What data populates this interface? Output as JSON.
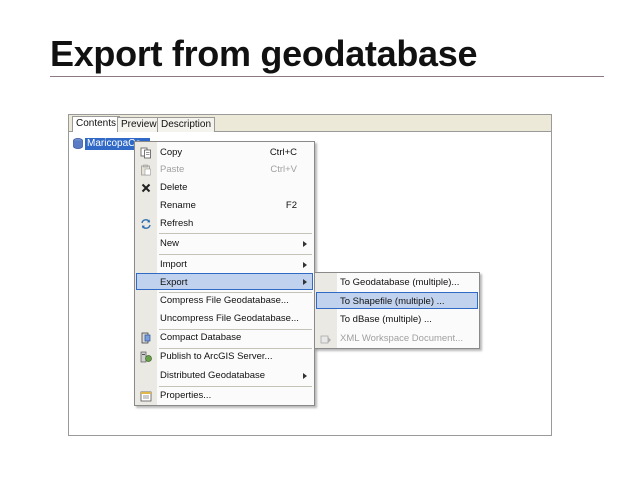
{
  "slide": {
    "title": "Export from geodatabase"
  },
  "tabs": [
    {
      "label": "Contents",
      "active": true
    },
    {
      "label": "Preview",
      "active": false
    },
    {
      "label": "Description",
      "active": false
    }
  ],
  "tree": {
    "selected_label": "MaricopaCo..."
  },
  "context_menu": {
    "copy": {
      "label": "Copy",
      "shortcut": "Ctrl+C",
      "icon": "copy-icon"
    },
    "paste": {
      "label": "Paste",
      "shortcut": "Ctrl+V",
      "icon": "paste-icon"
    },
    "delete": {
      "label": "Delete",
      "icon": "delete-icon"
    },
    "rename": {
      "label": "Rename",
      "shortcut": "F2"
    },
    "refresh": {
      "label": "Refresh",
      "icon": "refresh-icon"
    },
    "new": {
      "label": "New"
    },
    "import": {
      "label": "Import"
    },
    "export": {
      "label": "Export"
    },
    "compress_file": {
      "label": "Compress File Geodatabase..."
    },
    "uncompress_file": {
      "label": "Uncompress File Geodatabase..."
    },
    "compact": {
      "label": "Compact Database",
      "icon": "compact-icon"
    },
    "publish": {
      "label": "Publish to ArcGIS Server...",
      "icon": "publish-icon"
    },
    "distributed": {
      "label": "Distributed Geodatabase"
    },
    "properties": {
      "label": "Properties...",
      "icon": "properties-icon"
    }
  },
  "export_submenu": {
    "to_geodatabase": {
      "label": "To Geodatabase (multiple)..."
    },
    "to_shapefile": {
      "label": "To Shapefile (multiple) ..."
    },
    "to_dbase": {
      "label": "To dBase (multiple) ..."
    },
    "xml_workspace": {
      "label": "XML Workspace Document...",
      "icon": "xml-workspace-icon"
    }
  },
  "colors": {
    "selection": "#3169c6",
    "menu_highlight": "#c1d2ee",
    "menu_highlight_border": "#316ac5",
    "title_rule": "#8b7a86"
  }
}
